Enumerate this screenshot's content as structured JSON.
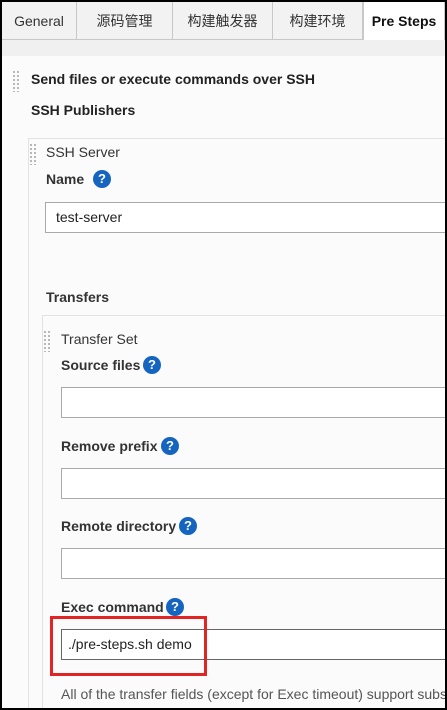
{
  "tabs": [
    {
      "label": "General"
    },
    {
      "label": "源码管理"
    },
    {
      "label": "构建触发器"
    },
    {
      "label": "构建环境"
    },
    {
      "label": "Pre Steps"
    }
  ],
  "section": {
    "title": "Send files or execute commands over SSH",
    "publishers_label": "SSH Publishers",
    "server": {
      "title": "SSH Server",
      "name_label": "Name",
      "name_value": "test-server"
    },
    "transfers_label": "Transfers",
    "transfer_set": {
      "title": "Transfer Set",
      "fields": [
        {
          "label": "Source files",
          "value": ""
        },
        {
          "label": "Remove prefix",
          "value": ""
        },
        {
          "label": "Remote directory",
          "value": ""
        },
        {
          "label": "Exec command",
          "value": "./pre-steps.sh demo"
        }
      ],
      "footnote": "All of the transfer fields (except for Exec timeout) support subs"
    }
  },
  "help_icon_glyph": "?",
  "colors": {
    "help_icon": "#1565c0",
    "highlight": "#e32424"
  }
}
